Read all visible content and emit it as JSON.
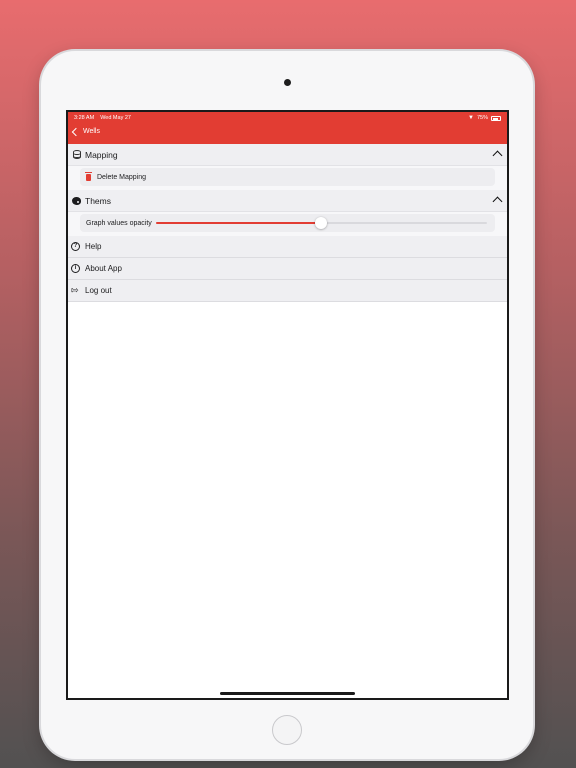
{
  "status_bar": {
    "time": "3:28 AM",
    "date": "Wed May 27",
    "battery": "75%"
  },
  "nav": {
    "back_label": "Wells"
  },
  "sections": {
    "mapping": {
      "title": "Mapping",
      "delete_label": "Delete Mapping"
    },
    "thems": {
      "title": "Thems",
      "opacity_label": "Graph values opacity",
      "opacity_value": 0.5
    }
  },
  "menu": {
    "help": "Help",
    "about": "About App",
    "logout": "Log out"
  },
  "colors": {
    "accent": "#e23d33",
    "row_bg": "#efeff2"
  },
  "icons": {
    "mapping": "database-icon",
    "thems": "palette-icon",
    "help": "question-circle-icon",
    "about": "info-circle-icon",
    "logout": "logout-icon",
    "delete": "trash-icon"
  }
}
